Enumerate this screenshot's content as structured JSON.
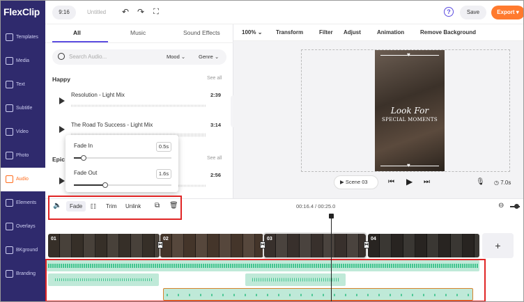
{
  "app": {
    "logo": "FlexClip",
    "ratio": "9:16",
    "title": "Untitled",
    "save": "Save",
    "export": "Export"
  },
  "sidebar": {
    "items": [
      {
        "label": "Templates",
        "icon": "templates-icon"
      },
      {
        "label": "Media",
        "icon": "media-icon"
      },
      {
        "label": "Text",
        "icon": "text-icon"
      },
      {
        "label": "Subtitle",
        "icon": "subtitle-icon"
      },
      {
        "label": "Video",
        "icon": "video-icon"
      },
      {
        "label": "Photo",
        "icon": "photo-icon"
      },
      {
        "label": "Audio",
        "icon": "audio-icon",
        "active": true
      },
      {
        "label": "Elements",
        "icon": "elements-icon"
      },
      {
        "label": "Overlays",
        "icon": "overlays-icon"
      },
      {
        "label": "BKground",
        "icon": "background-icon"
      },
      {
        "label": "Branding",
        "icon": "branding-icon"
      }
    ]
  },
  "panel": {
    "tabs": [
      "All",
      "Music",
      "Sound Effects"
    ],
    "search_placeholder": "Search Audio...",
    "mood": "Mood",
    "genre": "Genre",
    "sections": [
      {
        "name": "Happy",
        "see_all": "See all",
        "tracks": [
          {
            "name": "Resolution - Light Mix",
            "duration": "2:39"
          },
          {
            "name": "The Road To Success - Light Mix",
            "duration": "3:14"
          }
        ]
      },
      {
        "name": "Epic",
        "see_all": "See all",
        "tracks": [
          {
            "name": "",
            "duration": "2:56"
          }
        ]
      }
    ]
  },
  "fade_popup": {
    "fade_in_label": "Fade In",
    "fade_in_value": "0.5s",
    "fade_in_level": 0.1,
    "fade_out_label": "Fade Out",
    "fade_out_value": "1.6s",
    "fade_out_level": 0.32
  },
  "edit_toolbar": {
    "zoom": "100%",
    "items": [
      "Transform",
      "Filter",
      "Adjust",
      "Animation",
      "Remove Background"
    ]
  },
  "preview": {
    "line1": "Look For",
    "line2": "SPECIAL MOMENTS",
    "scene": "Scene 03",
    "duration": "7.0s"
  },
  "timeline": {
    "tools": {
      "fade": "Fade",
      "trim": "Trim",
      "unlink": "Unlink"
    },
    "time": "00:16.4 / 00:25.0",
    "clips": [
      "01",
      "02",
      "03",
      "04"
    ],
    "add": "+"
  },
  "colors": {
    "sidebar": "#2f2a6d",
    "accent": "#ff7a2e",
    "primary": "#5b4ce0",
    "audio": "#bfe9d8",
    "highlight": "#e02424"
  }
}
